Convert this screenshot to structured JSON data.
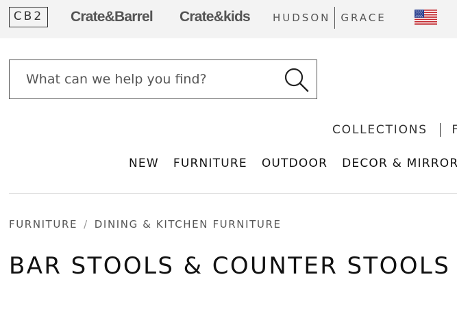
{
  "brands": {
    "cb2": "CB2",
    "crate_and_barrel": "Crate&Barrel",
    "crate_and_kids": "Crate&kids",
    "hudson": "HUDSON",
    "grace": "GRACE"
  },
  "flag_icon": "us-flag-icon",
  "search": {
    "placeholder": "What can we help you find?",
    "value": "",
    "icon": "search-icon"
  },
  "utility_nav": {
    "items": [
      "COLLECTIONS",
      "F"
    ]
  },
  "main_nav": {
    "items": [
      "NEW",
      "FURNITURE",
      "OUTDOOR",
      "DECOR & MIRRORS"
    ]
  },
  "breadcrumb": {
    "items": [
      "FURNITURE",
      "DINING & KITCHEN FURNITURE"
    ],
    "separator": "/"
  },
  "page_title": "BAR STOOLS & COUNTER STOOLS",
  "colors": {
    "topbar_bg": "#f3f3f3",
    "text": "#111111",
    "muted": "#555555",
    "rule": "#cfcfcf"
  }
}
